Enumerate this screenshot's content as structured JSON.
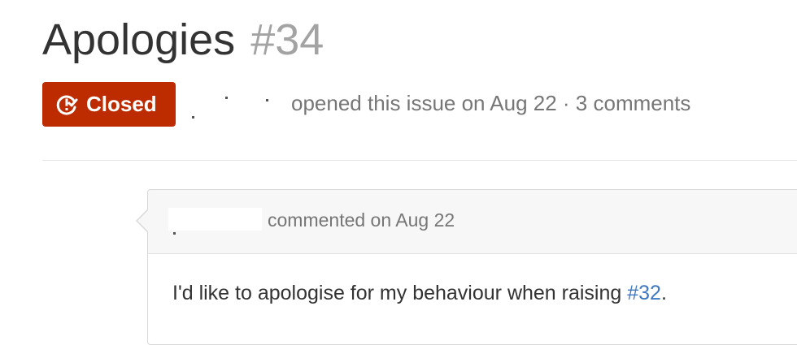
{
  "issue": {
    "title": "Apologies",
    "number": "#34",
    "state": "Closed",
    "meta": "opened this issue on Aug 22 · 3 comments",
    "colors": {
      "closed_badge": "#bd2c00",
      "link": "#4078c0"
    },
    "state_icon": "issue-closed-icon"
  },
  "comment": {
    "meta": "commented on Aug 22",
    "body_prefix": "I'd like to apologise for my behaviour when raising ",
    "link_text": "#32",
    "body_suffix": "."
  }
}
